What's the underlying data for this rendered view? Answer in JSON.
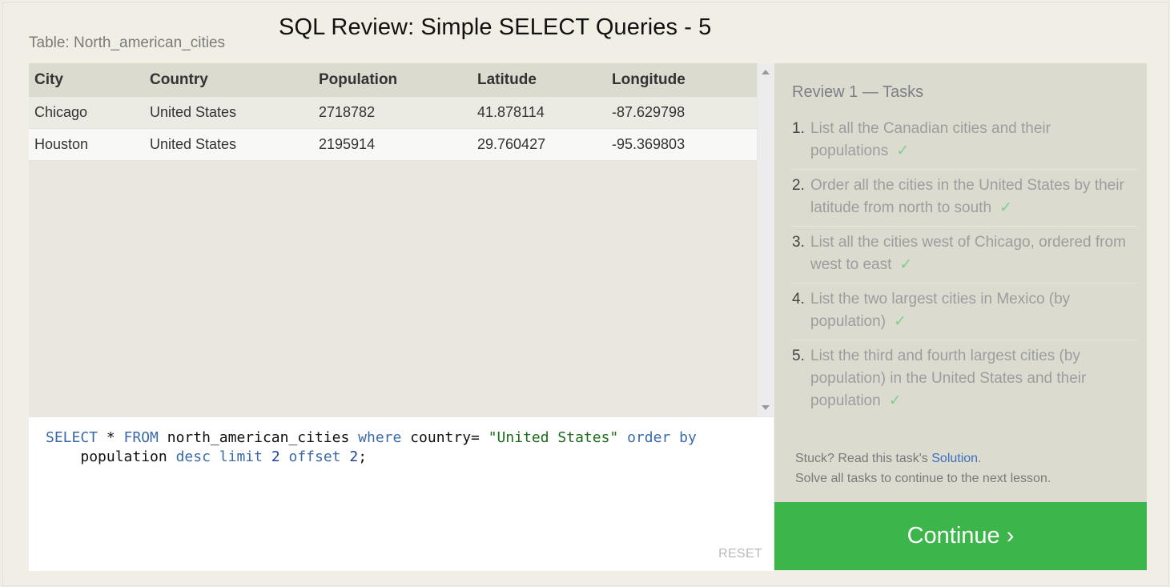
{
  "header": {
    "table_caption": "Table: North_american_cities",
    "title": "SQL Review: Simple SELECT Queries - 5"
  },
  "results": {
    "columns": [
      "City",
      "Country",
      "Population",
      "Latitude",
      "Longitude"
    ],
    "rows": [
      [
        "Chicago",
        "United States",
        "2718782",
        "41.878114",
        "-87.629798"
      ],
      [
        "Houston",
        "United States",
        "2195914",
        "29.760427",
        "-95.369803"
      ]
    ]
  },
  "editor": {
    "tokens": {
      "select": "SELECT",
      "star": " * ",
      "from": "FROM",
      "table": " north_american_cities ",
      "where": "where",
      "col": " country= ",
      "value": "\"United States\"",
      "space1": " ",
      "orderby": "order by",
      "indent": "\n    population ",
      "desc": "desc",
      "space2": " ",
      "limit": "limit",
      "space3": " ",
      "n1": "2",
      "space4": " ",
      "offset": "offset",
      "space5": " ",
      "n2": "2",
      "end": ";"
    },
    "reset_label": "RESET"
  },
  "tasks": {
    "title": "Review 1 — Tasks",
    "items": [
      {
        "num": "1.",
        "text": "List all the Canadian cities and their populations",
        "check": "✓"
      },
      {
        "num": "2.",
        "text": "Order all the cities in the United States by their latitude from north to south",
        "check": "✓"
      },
      {
        "num": "3.",
        "text": "List all the cities west of Chicago, ordered from west to east",
        "check": "✓"
      },
      {
        "num": "4.",
        "text": "List the two largest cities in Mexico (by population)",
        "check": "✓"
      },
      {
        "num": "5.",
        "text": "List the third and fourth largest cities (by population) in the United States and their population",
        "check": "✓"
      }
    ],
    "stuck_prefix": "Stuck? Read this task's ",
    "solution_link": "Solution",
    "stuck_suffix": ".",
    "solve_note": "Solve all tasks to continue to the next lesson."
  },
  "continue_label": "Continue ›",
  "colors": {
    "continue_bg": "#3cb54a",
    "check": "#7fcf8c",
    "link": "#3d6fbd"
  }
}
